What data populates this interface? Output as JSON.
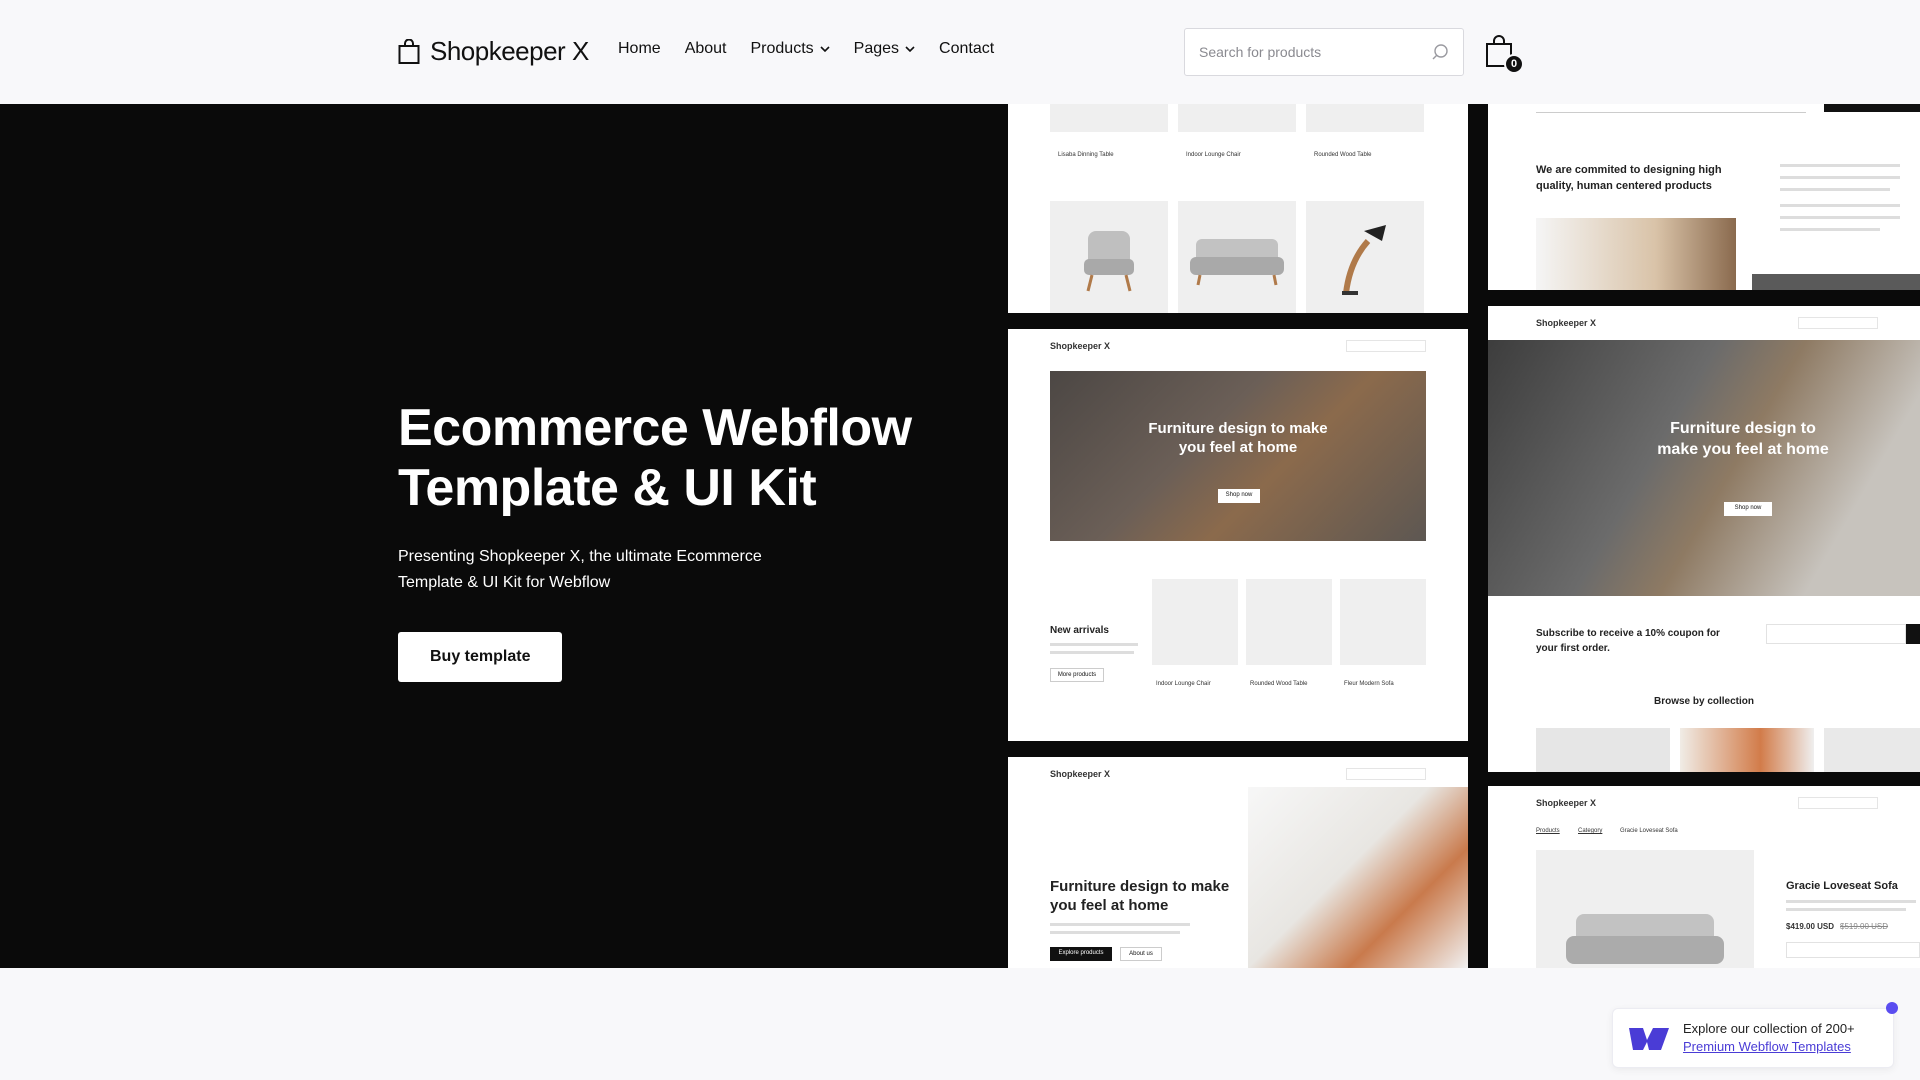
{
  "header": {
    "logo_text": "Shopkeeper X",
    "nav": [
      {
        "label": "Home"
      },
      {
        "label": "About"
      },
      {
        "label": "Products"
      },
      {
        "label": "Pages"
      },
      {
        "label": "Contact"
      }
    ],
    "search_placeholder": "Search for products",
    "cart_count": "0"
  },
  "hero": {
    "title_line1": "Ecommerce Webflow",
    "title_line2": "Template & UI Kit",
    "subtitle": "Presenting Shopkeeper X, the ultimate Ecommerce Template & UI Kit for Webflow",
    "cta_label": "Buy template"
  },
  "previews": {
    "top_left_products": [
      "Lisaba Dinning Table",
      "Indoor Lounge Chair",
      "Rounded Wood Table"
    ],
    "top_right_text": "We are commited to designing high quality, human centered products",
    "mid_left_logo": "Shopkeeper X",
    "mid_left_heading": "Furniture design to make you feel at home",
    "mid_left_shop": "Shop now",
    "mid_left_new_arrivals": "New arrivals",
    "mid_left_more": "More products",
    "mid_left_items": [
      "Indoor Lounge Chair",
      "Rounded Wood Table",
      "Fleur Modern Sofa"
    ],
    "mid_right_logo": "Shopkeeper X",
    "mid_right_heading": "Furniture design to make you feel at home",
    "mid_right_shop": "Shop now",
    "mid_right_subscribe": "Subscribe to receive a 10% coupon for your first order.",
    "mid_right_browse": "Browse by collection",
    "bot_left_logo": "Shopkeeper X",
    "bot_left_heading": "Furniture design to make you feel at home",
    "bot_left_btn": "Explore products",
    "bot_left_btn2": "About us",
    "bot_right_logo": "Shopkeeper X",
    "bot_right_product": "Gracie Loveseat Sofa",
    "bot_right_price": "$419.00 USD",
    "bot_right_old_price": "$519.00 USD",
    "bot_right_crumb1": "Products",
    "bot_right_crumb2": "Category",
    "bot_right_crumb3": "Gracie Loveseat Sofa"
  },
  "promo": {
    "line1": "Explore our collection of 200+",
    "link": "Premium Webflow Templates"
  },
  "colors": {
    "hero_bg": "#0a0a0a",
    "page_bg": "#f8f8fa",
    "accent": "#4a3cd6"
  }
}
